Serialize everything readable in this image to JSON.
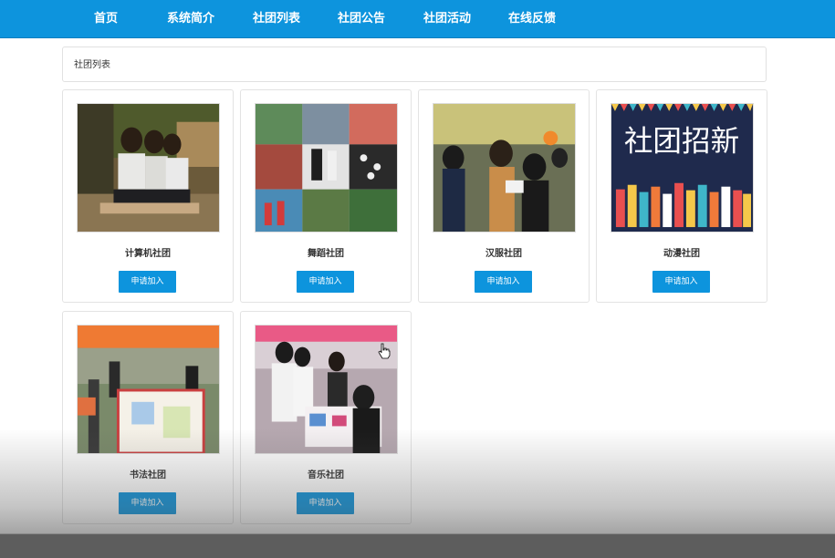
{
  "nav": {
    "items": [
      {
        "label": "首页"
      },
      {
        "label": "系统简介"
      },
      {
        "label": "社团列表"
      },
      {
        "label": "社团公告"
      },
      {
        "label": "社团活动"
      },
      {
        "label": "在线反馈"
      }
    ],
    "background": "#0d94dd"
  },
  "panel": {
    "title": "社团列表"
  },
  "clubs": [
    {
      "name": "计算机社团",
      "button": "申请加入"
    },
    {
      "name": "舞蹈社团",
      "button": "申请加入"
    },
    {
      "name": "汉服社团",
      "button": "申请加入"
    },
    {
      "name": "动漫社团",
      "button": "申请加入",
      "poster_text": "社团招新"
    },
    {
      "name": "书法社团",
      "button": "申请加入"
    },
    {
      "name": "音乐社团",
      "button": "申请加入"
    }
  ],
  "colors": {
    "accent": "#0d94dd",
    "button_text": "#ffffff"
  }
}
